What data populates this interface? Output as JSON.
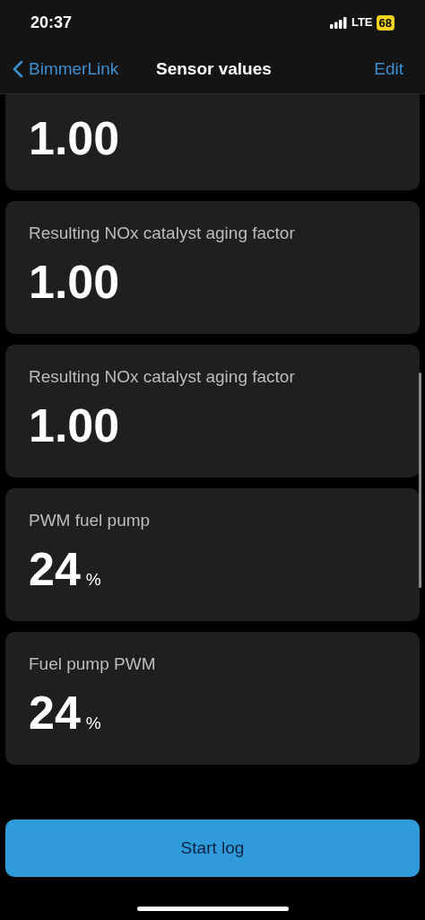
{
  "status_bar": {
    "time": "20:37",
    "network": "LTE",
    "battery": "68"
  },
  "nav": {
    "back": "BimmerLink",
    "title": "Sensor values",
    "action": "Edit"
  },
  "cards": [
    {
      "value": "1.00"
    },
    {
      "label": "Resulting NOx catalyst aging factor",
      "value": "1.00"
    },
    {
      "label": "Resulting NOx catalyst aging factor",
      "value": "1.00"
    },
    {
      "label": "PWM fuel pump",
      "value": "24",
      "unit": "%"
    },
    {
      "label": "Fuel pump PWM",
      "value": "24",
      "unit": "%"
    }
  ],
  "button": {
    "label": "Start log"
  }
}
